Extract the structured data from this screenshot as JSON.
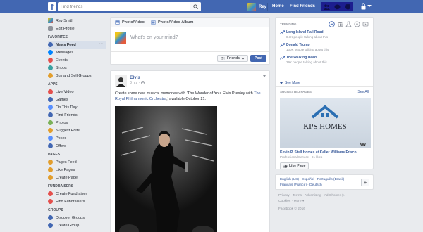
{
  "topbar": {
    "search_placeholder": "Find friends",
    "profile_name": "Rey",
    "home_label": "Home",
    "find_friends_label": "Find Friends"
  },
  "sidebar": {
    "profile_name": "Rey Smith",
    "edit_profile": "Edit Profile",
    "favorites_header": "FAVORITES",
    "favorites": [
      {
        "label": "News Feed",
        "icon": "news-feed-icon",
        "count": "···",
        "color": "#4267b2"
      },
      {
        "label": "Messages",
        "icon": "messages-icon",
        "color": "#0084ff"
      },
      {
        "label": "Events",
        "icon": "events-icon",
        "color": "#e4504d"
      },
      {
        "label": "Shops",
        "icon": "shops-icon",
        "color": "#3aa0a0"
      },
      {
        "label": "Buy and Sell Groups",
        "icon": "buy-sell-icon",
        "color": "#e29e2d"
      }
    ],
    "apps_header": "APPS",
    "apps": [
      {
        "label": "Live Video",
        "icon": "live-video-icon",
        "color": "#e4504d"
      },
      {
        "label": "Games",
        "icon": "games-icon",
        "color": "#4267b2"
      },
      {
        "label": "On This Day",
        "icon": "on-this-day-icon",
        "color": "#5890ff"
      },
      {
        "label": "Find Friends",
        "icon": "find-friends-icon",
        "color": "#4267b2"
      },
      {
        "label": "Photos",
        "icon": "photos-icon",
        "color": "#7ab158"
      },
      {
        "label": "Suggest Edits",
        "icon": "suggest-edits-icon",
        "color": "#e29e2d"
      },
      {
        "label": "Pokes",
        "icon": "pokes-icon",
        "color": "#5890ff"
      },
      {
        "label": "Offers",
        "icon": "offers-icon",
        "color": "#4267b2"
      }
    ],
    "pages_header": "PAGES",
    "pages": [
      {
        "label": "Pages Feed",
        "icon": "pages-feed-icon",
        "count": "1",
        "color": "#e29e2d"
      },
      {
        "label": "Like Pages",
        "icon": "like-pages-icon",
        "color": "#e29e2d"
      },
      {
        "label": "Create Page",
        "icon": "create-page-icon",
        "color": "#e29e2d"
      }
    ],
    "fundraisers_header": "FUNDRAISERS",
    "fundraisers": [
      {
        "label": "Create Fundraiser",
        "icon": "create-fundraiser-icon",
        "color": "#e4504d"
      },
      {
        "label": "Find Fundraisers",
        "icon": "find-fundraisers-icon",
        "color": "#e4504d"
      }
    ],
    "groups_header": "GROUPS",
    "groups": [
      {
        "label": "Discover Groups",
        "icon": "discover-groups-icon",
        "color": "#4267b2"
      },
      {
        "label": "Create Group",
        "icon": "create-group-icon",
        "color": "#4267b2"
      }
    ]
  },
  "composer": {
    "tab_photo_video": "Photo/Video",
    "tab_photo_album": "Photo/Video Album",
    "placeholder": "What's on your mind?",
    "audience": "Friends",
    "post_label": "Post"
  },
  "post": {
    "author": "Elvis",
    "time": "8 hrs · ",
    "text_before": "Create some new musical memories with 'The Wonder of You: Elvis Presley with ",
    "text_link": "The Royal Philharmonic Orchestra",
    "text_after": ",' available October 21."
  },
  "trending": {
    "header": "TRENDING",
    "items": [
      {
        "title": "Long Island Rail Road",
        "sub": "8.1K people talking about this"
      },
      {
        "title": "Donald Trump",
        "sub": "130K people talking about this"
      },
      {
        "title": "The Walking Dead",
        "sub": "29K people talking about this"
      }
    ],
    "see_more": "See More"
  },
  "suggested": {
    "header": "SUGGESTED PAGES",
    "see_all": "See All",
    "logo_text": "KPS HOMES",
    "kw_text": "kw",
    "name": "Kevin P. Stull Homes at Keller Williams Frisco",
    "sub": "Professional Service · 91 likes",
    "like_label": "Like Page"
  },
  "languages": {
    "line1": "English (US) · Español · Português (Brasil) ·",
    "line2": "Français (France) · Deutsch"
  },
  "footer": {
    "line1": "Privacy · Terms · Advertising · Ad Choices ▷ ·",
    "line2": "Cookies · More ▾",
    "line3": "Facebook © 2016"
  }
}
